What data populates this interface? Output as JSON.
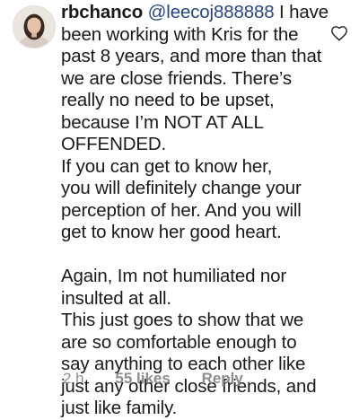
{
  "comment": {
    "username": "rbchanco",
    "mention": "@leecoj888888",
    "lines": [
      " I have",
      "been working with Kris for the",
      "past 8 years, and more than that",
      "we are close friends. There’s",
      "really no need to be upset,",
      "because I’m NOT AT ALL",
      "OFFENDED.",
      "If you can get to know her,",
      "you will definitely change your",
      "perception of her. And you will",
      "get to know her good heart.",
      "",
      "Again, Im not humiliated nor",
      "insulted at all.",
      "This just goes to show that we",
      "are so comfortable enough to",
      "say anything to each other like",
      "just any other close friends, and",
      "just like family."
    ],
    "time": "2 h",
    "likes": "55 likes",
    "reply_label": "Reply",
    "like_icon": "heart-outline-icon",
    "colors": {
      "text": "#1a1a1a",
      "mention": "#28467f",
      "meta": "#8e8e8e",
      "background": "#ffffff"
    }
  }
}
